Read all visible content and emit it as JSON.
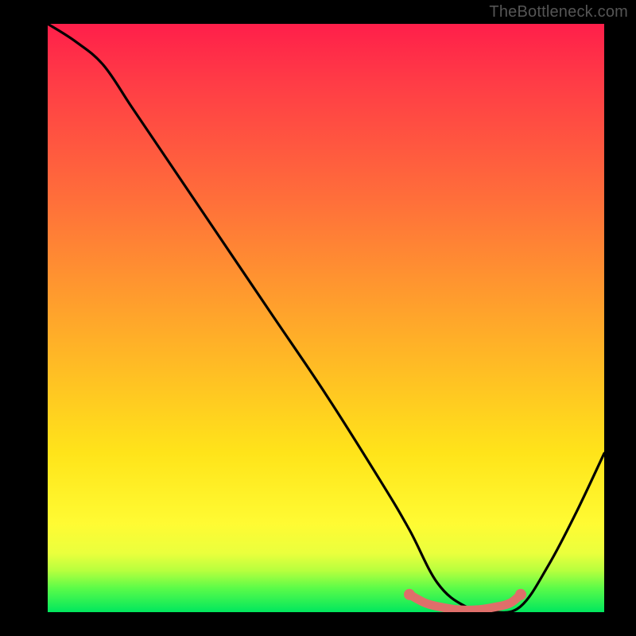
{
  "watermark": "TheBottleneck.com",
  "chart_data": {
    "type": "line",
    "title": "",
    "xlabel": "",
    "ylabel": "",
    "xlim": [
      0,
      100
    ],
    "ylim": [
      0,
      100
    ],
    "grid": false,
    "legend": false,
    "gradient_colors": {
      "top": "#ff1f4a",
      "mid_upper": "#ff7a36",
      "mid": "#ffe41a",
      "mid_lower": "#fffb33",
      "bottom": "#00e75e"
    },
    "series": [
      {
        "name": "main-curve",
        "color": "#000000",
        "x": [
          0,
          5,
          10,
          15,
          20,
          30,
          40,
          50,
          60,
          65,
          70,
          75,
          80,
          85,
          90,
          95,
          100
        ],
        "y": [
          100,
          97,
          93,
          86,
          79,
          65,
          51,
          37,
          22,
          14,
          5,
          1,
          0,
          1,
          8,
          17,
          27
        ]
      },
      {
        "name": "marker-band",
        "color": "#df6f6a",
        "x": [
          65,
          68,
          71,
          74,
          77,
          80,
          83,
          85
        ],
        "y": [
          3,
          1.5,
          0.8,
          0.4,
          0.4,
          0.8,
          1.5,
          3
        ]
      }
    ]
  }
}
